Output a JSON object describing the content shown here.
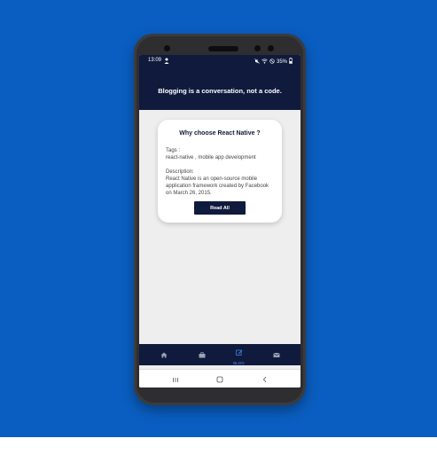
{
  "status_bar": {
    "time": "13:09",
    "battery": "35%",
    "notification_icon": "person-icon",
    "status_icons": [
      "mute-icon",
      "wifi-icon",
      "alarm-icon",
      "battery-icon"
    ]
  },
  "header": {
    "title": "Blogging is a conversation, not a code."
  },
  "card": {
    "title": "Why choose React Native ?",
    "tags_label": "Tags :",
    "tags_value": "react-native , mobile app development",
    "description_label": "Description:",
    "description_value": "React Native is an open-source mobile application framework created by Facebook on March 26, 2015.",
    "button_label": "Read All"
  },
  "tab_bar": {
    "items": [
      {
        "icon": "home-icon",
        "label": ""
      },
      {
        "icon": "briefcase-icon",
        "label": ""
      },
      {
        "icon": "edit-icon",
        "label": "BLOG",
        "active": true
      },
      {
        "icon": "mail-icon",
        "label": ""
      }
    ],
    "active_color": "#4b8ef2",
    "inactive_color": "#9aa3b8"
  },
  "nav_bar": {
    "buttons": [
      "recents-icon",
      "home-circle-icon",
      "back-icon"
    ]
  },
  "colors": {
    "background": "#0a5ec1",
    "header": "#0f1a3d",
    "screen": "#eeeeee"
  }
}
